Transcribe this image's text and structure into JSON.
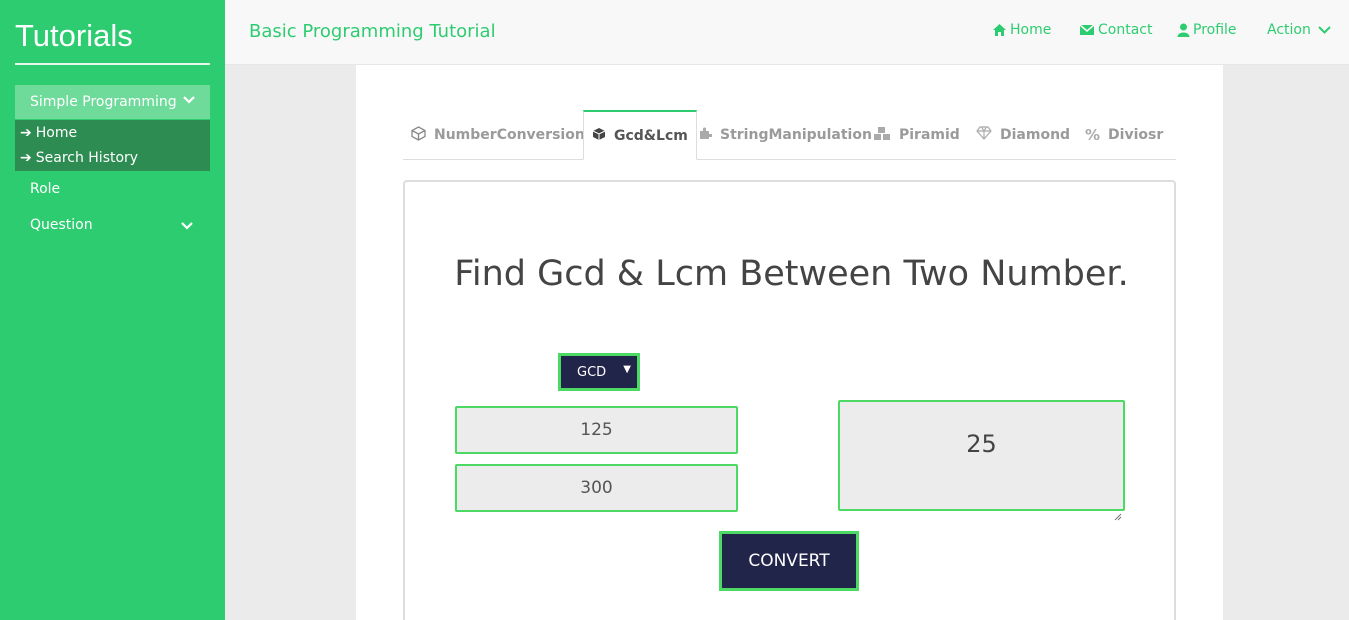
{
  "sidebar": {
    "brand": "Tutorials",
    "menu_simple": "Simple Programming",
    "sub_items": [
      {
        "label": "Home"
      },
      {
        "label": "Search History"
      }
    ],
    "role": "Role",
    "question": "Question"
  },
  "topbar": {
    "title": "Basic Programming Tutorial",
    "nav": {
      "home": "Home",
      "contact": "Contact",
      "profile": "Profile",
      "action": "Action"
    }
  },
  "tabs": [
    {
      "label": "NumberConversion",
      "icon": "cube-outline-icon"
    },
    {
      "label": "Gcd&Lcm",
      "icon": "cube-icon",
      "active": true
    },
    {
      "label": "StringManipulation",
      "icon": "puzzle-icon"
    },
    {
      "label": "Piramid",
      "icon": "cubes-icon"
    },
    {
      "label": "Diamond",
      "icon": "diamond-icon"
    },
    {
      "label": "Diviosr",
      "icon": "percent-icon"
    }
  ],
  "form": {
    "heading": "Find Gcd & Lcm Between Two Number.",
    "select_value": "GCD",
    "input1": "125",
    "input2": "300",
    "result": "25",
    "convert_label": "CONVERT"
  },
  "colors": {
    "accent": "#2ecc71",
    "button_bg": "#22254a",
    "border_green": "#4cd964"
  }
}
